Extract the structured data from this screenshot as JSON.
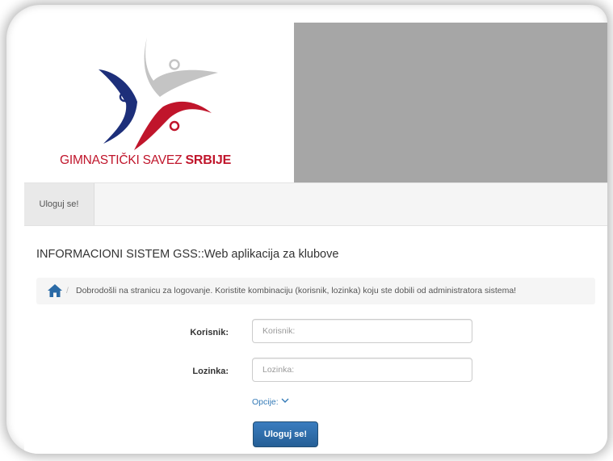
{
  "logo": {
    "text_part1": "GIMNASTIČKI SAVEZ",
    "text_part2": "SRBIJE",
    "colors": {
      "red": "#c0152b",
      "navy": "#1d2f7a",
      "gray": "#c4c4c4"
    }
  },
  "banner": {
    "color": "#a6a6a6"
  },
  "nav": {
    "login_item": "Uloguj se!"
  },
  "app_title": "INFORMACIONI SISTEM GSS::Web aplikacija za klubove",
  "breadcrumb": {
    "home_icon": "home-icon",
    "separator": "/",
    "message": "Dobrodošli na stranicu za logovanje. Koristite kombinaciju (korisnik, lozinka) koju ste dobili od administratora sistema!"
  },
  "form": {
    "username_label": "Korisnik:",
    "username_placeholder": "Korisnik:",
    "password_label": "Lozinka:",
    "password_placeholder": "Lozinka:",
    "options_label": "Opcije:",
    "options_icon": "chevron-down-icon",
    "submit_label": "Uloguj se!"
  },
  "colors": {
    "primary_button": "#2e6da4",
    "link": "#337ab7"
  }
}
